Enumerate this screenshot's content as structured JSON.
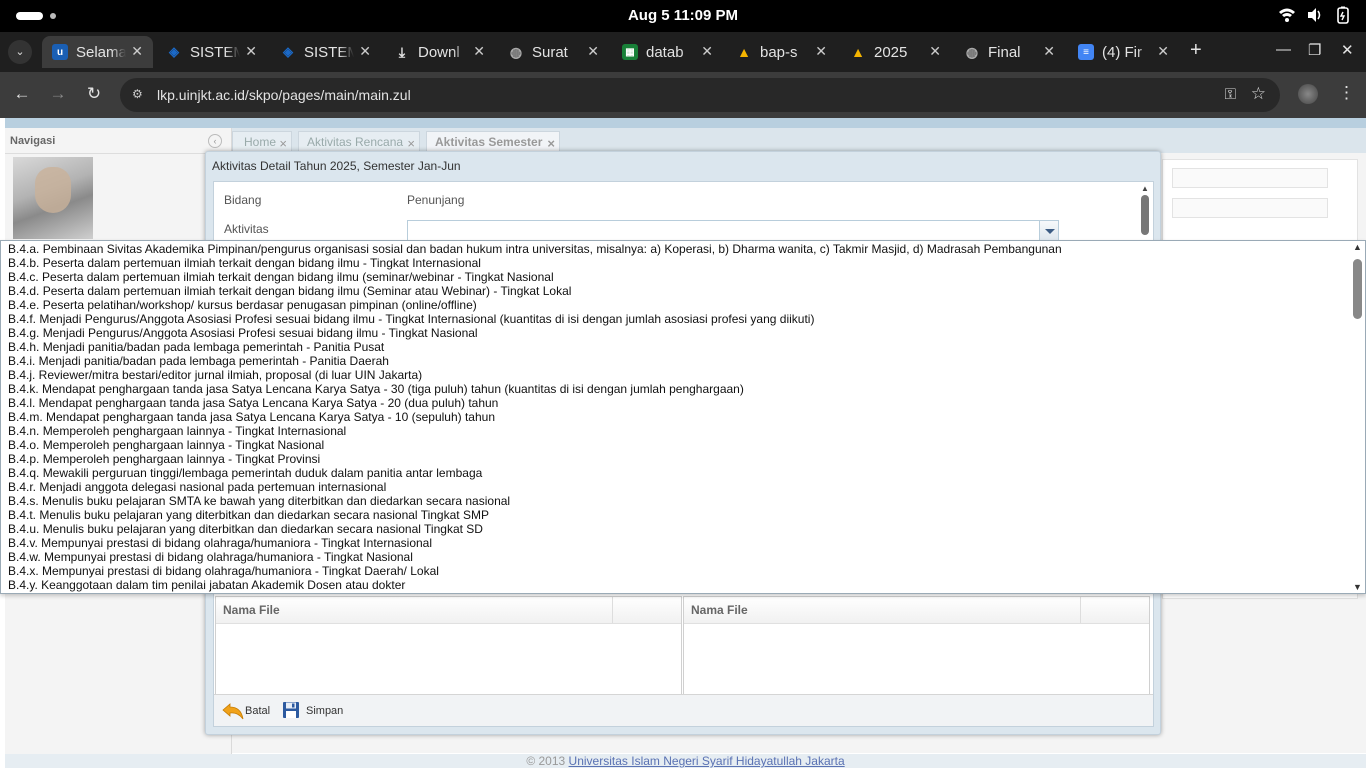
{
  "system": {
    "clock": "Aug 5  11:09 PM"
  },
  "browser": {
    "tabs": [
      {
        "title": "Selamat",
        "icon": "uinjkt-favicon",
        "color": "#1a5fb4",
        "active": true
      },
      {
        "title": "SISTEM",
        "icon": "sistem-favicon",
        "color": "#1b6ac9"
      },
      {
        "title": "SISTEM",
        "icon": "sistem-favicon",
        "color": "#1b6ac9"
      },
      {
        "title": "Downl",
        "icon": "download-icon",
        "color": "#555"
      },
      {
        "title": "Surat",
        "icon": "globe-icon",
        "color": "#666"
      },
      {
        "title": "datab",
        "icon": "sheets-icon",
        "color": "#188038"
      },
      {
        "title": "bap-s",
        "icon": "drive-icon",
        "color": "#f4b400"
      },
      {
        "title": "2025",
        "icon": "drive-icon",
        "color": "#f4b400"
      },
      {
        "title": "Final",
        "icon": "globe-icon",
        "color": "#666"
      },
      {
        "title": "(4) Fir",
        "icon": "docs-icon",
        "color": "#4285f4"
      }
    ],
    "url": "lkp.uinjkt.ac.id/skpo/pages/main/main.zul"
  },
  "app": {
    "nav_title": "Navigasi",
    "tabs": [
      {
        "label": "Home",
        "active": false
      },
      {
        "label": "Aktivitas Rencana",
        "active": false
      },
      {
        "label": "Aktivitas Semester",
        "active": true
      }
    ],
    "footer_text": "© 2013 ",
    "footer_link": "Universitas Islam Negeri Syarif Hidayatullah Jakarta"
  },
  "modal": {
    "title": "Aktivitas Detail Tahun 2025, Semester Jan-Jun",
    "bidang_label": "Bidang",
    "bidang_value": "Penunjang",
    "aktivitas_label": "Aktivitas",
    "aktivitas_value": "",
    "grid_left_header": "Nama File",
    "grid_right_header": "Nama File",
    "batal_label": "Batal",
    "simpan_label": "Simpan"
  },
  "dropdown_items": [
    "B.4.a. Pembinaan Sivitas Akademika Pimpinan/pengurus organisasi sosial dan badan hukum intra universitas, misalnya: a) Koperasi, b) Dharma wanita, c) Takmir Masjid, d) Madrasah Pembangunan",
    "B.4.b. Peserta dalam pertemuan ilmiah terkait dengan bidang ilmu - Tingkat Internasional",
    "B.4.c. Peserta dalam pertemuan ilmiah terkait dengan bidang ilmu (seminar/webinar - Tingkat Nasional",
    "B.4.d. Peserta dalam pertemuan ilmiah terkait dengan bidang ilmu (Seminar atau Webinar) - Tingkat Lokal",
    "B.4.e. Peserta pelatihan/workshop/ kursus berdasar penugasan pimpinan (online/offline)",
    "B.4.f. Menjadi Pengurus/Anggota Asosiasi Profesi sesuai bidang ilmu - Tingkat Internasional (kuantitas di isi dengan jumlah asosiasi profesi yang diikuti)",
    "B.4.g. Menjadi Pengurus/Anggota Asosiasi Profesi sesuai bidang ilmu - Tingkat Nasional",
    "B.4.h. Menjadi panitia/badan pada lembaga pemerintah - Panitia Pusat",
    "B.4.i. Menjadi panitia/badan pada lembaga pemerintah - Panitia Daerah",
    "B.4.j. Reviewer/mitra bestari/editor jurnal ilmiah, proposal (di luar UIN Jakarta)",
    "B.4.k. Mendapat penghargaan tanda jasa Satya Lencana Karya Satya - 30 (tiga puluh) tahun (kuantitas di isi dengan jumlah penghargaan)",
    "B.4.l. Mendapat penghargaan tanda jasa Satya Lencana Karya Satya - 20 (dua puluh) tahun",
    "B.4.m. Mendapat penghargaan tanda jasa Satya Lencana Karya Satya - 10 (sepuluh) tahun",
    "B.4.n. Memperoleh penghargaan lainnya - Tingkat Internasional",
    "B.4.o. Memperoleh penghargaan lainnya - Tingkat Nasional",
    "B.4.p. Memperoleh penghargaan lainnya - Tingkat Provinsi",
    "B.4.q. Mewakili perguruan tinggi/lembaga pemerintah duduk dalam panitia antar lembaga",
    "B.4.r. Menjadi anggota delegasi nasional pada pertemuan internasional",
    "B.4.s. Menulis buku pelajaran SMTA ke bawah yang diterbitkan dan diedarkan secara nasional",
    "B.4.t. Menulis buku pelajaran yang diterbitkan dan diedarkan secara nasional Tingkat SMP",
    "B.4.u. Menulis buku pelajaran yang diterbitkan dan diedarkan secara nasional Tingkat SD",
    "B.4.v. Mempunyai prestasi di bidang olahraga/humaniora - Tingkat Internasional",
    "B.4.w. Mempunyai prestasi di bidang olahraga/humaniora - Tingkat Nasional",
    "B.4.x. Mempunyai prestasi di bidang olahraga/humaniora - Tingkat Daerah/ Lokal",
    "B.4.y. Keanggotaan dalam tim penilai jabatan Akademik Dosen atau dokter"
  ]
}
